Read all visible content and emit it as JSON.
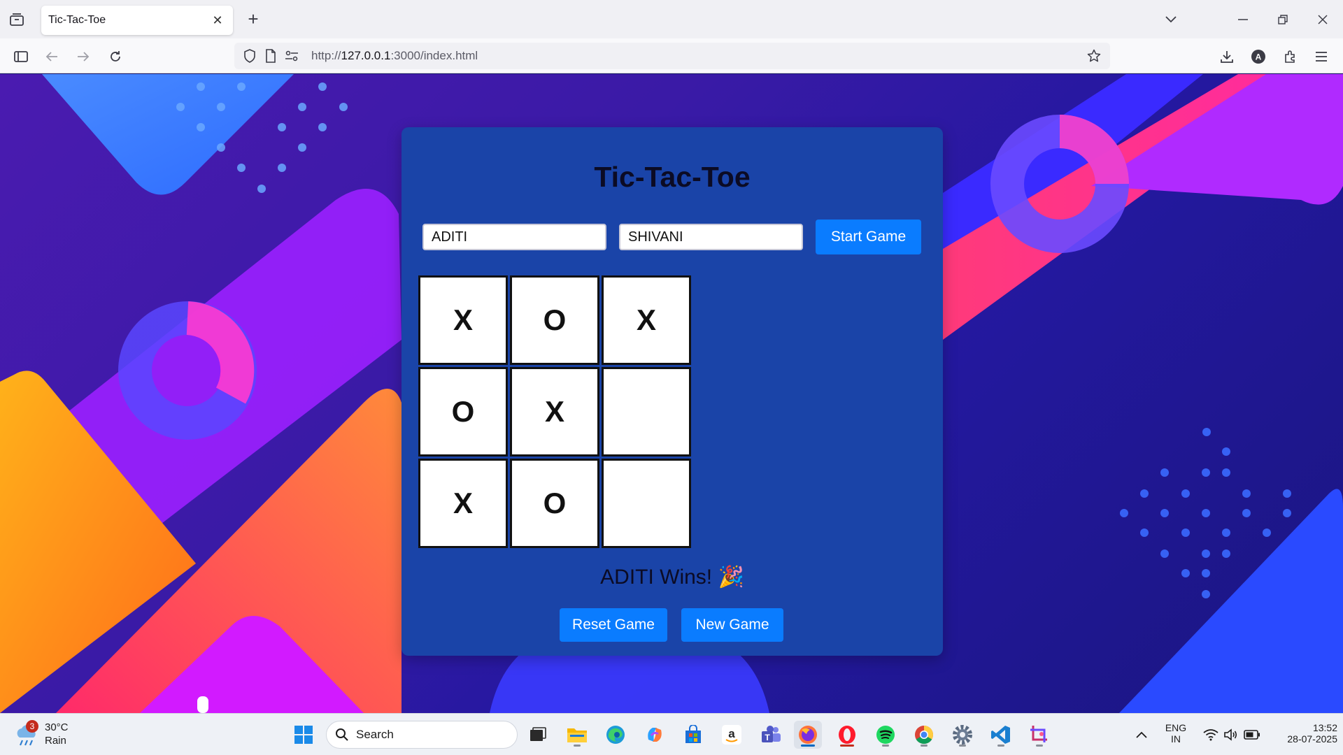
{
  "browser": {
    "tab_title": "Tic-Tac-Toe",
    "url_prefix": "http://",
    "url_host": "127.0.0.1",
    "url_rest": ":3000/index.html"
  },
  "game": {
    "title": "Tic-Tac-Toe",
    "player1_value": "ADITI",
    "player2_value": "SHIVANI",
    "start_label": "Start Game",
    "board": [
      "X",
      "O",
      "X",
      "O",
      "X",
      "",
      "X",
      "O",
      ""
    ],
    "status": "ADITI Wins! 🎉",
    "reset_label": "Reset Game",
    "new_label": "New Game"
  },
  "taskbar": {
    "weather_temp": "30°C",
    "weather_desc": "Rain",
    "weather_badge": "3",
    "search_label": "Search",
    "lang_top": "ENG",
    "lang_bottom": "IN",
    "time": "13:52",
    "date": "28-07-2025",
    "apps": [
      "start-icon",
      "task-view-icon",
      "file-explorer-icon",
      "edge-icon",
      "copilot-icon",
      "store-icon",
      "amazon-icon",
      "teams-icon",
      "firefox-icon",
      "opera-icon",
      "spotify-icon",
      "chrome-icon",
      "settings-icon",
      "vscode-icon",
      "snipping-tool-icon"
    ]
  },
  "colors": {
    "card": "#1a44a8",
    "button": "#0a7cff",
    "title": "#0b0b24"
  }
}
